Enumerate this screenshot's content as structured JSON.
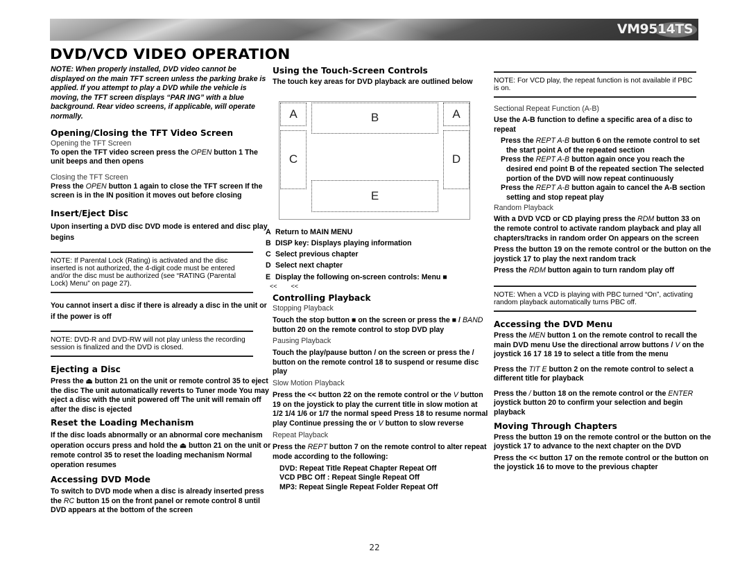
{
  "header": {
    "model": "VM9514TS",
    "page_title": "DVD/VCD VIDEO OPERATION"
  },
  "col1": {
    "intro_note": "NOTE: When properly installed, DVD video cannot be displayed on the main TFT screen unless the parking brake is applied. If you attempt to play a DVD while the vehicle is moving, the TFT screen displays “PAR ING” with a blue background. Rear video screens, if applicable, will operate normally.",
    "opening_heading": "Opening/Closing the TFT Video Screen",
    "opening_sub": "Opening the TFT Screen",
    "opening_text_a": "To open the TFT video screen  press the ",
    "opening_text_btn": "OPEN",
    "opening_text_b": " button  1  The unit beeps and then opens",
    "closing_sub": "Closing the TFT Screen",
    "closing_text_a": "Press the ",
    "closing_text_btn": "OPEN",
    "closing_text_b": " button  1  again to close the TFT screen  If the screen is in the IN position  it moves out before closing",
    "insert_heading": "Insert/Eject Disc",
    "insert_text": "Upon inserting a DVD disc  DVD mode is entered and disc play begins",
    "parental_note": "NOTE: If Parental Lock (Rating) is activated and the disc inserted is not authorized, the 4-digit code must be entered and/or the disc must be authorized (see “RATING (Parental Lock) Menu” on page 27).",
    "cannot_insert": "You cannot insert a disc if there is already a disc in the unit or if the power is off",
    "dvdr_note": "NOTE: DVD-R and DVD-RW will not play unless the recording session is finalized and the DVD is closed.",
    "eject_heading": "Ejecting a Disc",
    "eject_text": "Press the ⏏  button  21  on the unit or remote control  35  to eject the disc  The unit automatically reverts to Tuner mode  You may eject a disc with the unit powered off  The unit will remain off after the disc is ejected",
    "reset_heading": "Reset the Loading Mechanism",
    "reset_text": "If the disc loads abnormally or an abnormal core mechanism operation occurs  press and hold the ⏏  button  21  on the unit or remote control  35  to reset the loading mechanism  Normal operation resumes",
    "mode_heading": "Accessing DVD Mode",
    "mode_text_a": "To switch to DVD mode when a disc is already inserted press the ",
    "mode_text_btn": "RC",
    "mode_text_b": "  button  15  on the front panel or remote control  8  until DVD appears at the bottom of the screen"
  },
  "col2": {
    "touch_heading": "Using the Touch-Screen Controls",
    "touch_intro": "The touch key areas for DVD playback are outlined below",
    "zones": [
      "A",
      "B",
      "A",
      "C",
      "D",
      "E"
    ],
    "legend": [
      {
        "key": "A",
        "text": "Return to MAIN MENU"
      },
      {
        "key": "B",
        "text": "DISP key: Displays playing information"
      },
      {
        "key": "C",
        "text": "Select previous chapter"
      },
      {
        "key": "D",
        "text": "Select next chapter"
      },
      {
        "key": "E",
        "text": "Display the following on-screen controls: Menu  ■"
      }
    ],
    "legend_e_cont": "<<        <<",
    "playback_heading": "Controlling Playback",
    "stop_sub": "Stopping Playback",
    "stop_text_a": "Touch the stop button ■   on the screen or press the ■  /  ",
    "stop_text_btn": "BAND",
    "stop_text_b": " button  20  on the remote control to stop DVD play",
    "pause_sub": "Pausing Playback",
    "pause_text": "Touch the play/pause button /   on the screen or press the  /   button on the remote control  18  to suspend or resume disc play",
    "slow_sub": "Slow Motion Playback",
    "slow_text_a": "Press the << button  22  on the remote control or the ",
    "slow_text_v": "V",
    "slow_text_b": " button  19  on the joystick to play the current title in slow motion at 1/2  1/4  1/6 or 1/7  the normal speed  Press    18  to resume normal play  Continue pressing the  or ",
    "slow_text_v2": "V",
    "slow_text_c": " button to slow reverse",
    "repeat_sub": "Repeat Playback",
    "repeat_text_a": "Press the ",
    "repeat_text_btn": "REPT",
    "repeat_text_b": " button  7  on the remote control to alter repeat mode according to the following:",
    "repeat_modes": [
      "DVD: Repeat Title  Repeat Chapter  Repeat Off",
      "VCD  PBC Off : Repeat Single  Repeat Off",
      "MP3: Repeat Single  Repeat Folder  Repeat Off"
    ]
  },
  "col3": {
    "vcd_note": "NOTE: For VCD play, the repeat function is not available if PBC is on.",
    "ab_sub": "Sectional Repeat Function (A-B)",
    "ab_text": "Use the A-B function to define a specific area of a disc to repeat",
    "ab_steps": [
      {
        "a": "Press the ",
        "btn": "REPT A-B",
        "b": " button  6  on the remote control to set the start point  A  of the repeated section"
      },
      {
        "a": "Press the ",
        "btn": "REPT A-B",
        "b": " button again once you reach the desired end point  B  of the repeated section  The selected portion of the DVD will now repeat continuously"
      },
      {
        "a": "Press the ",
        "btn": "REPT A-B",
        "b": " button again to cancel the A-B section setting and stop repeat play"
      }
    ],
    "random_sub": "Random Playback",
    "random_text_a": "With a DVD  VCD  or CD playing  press the ",
    "random_text_btn": "RDM",
    "random_text_b": " button  33  on the remote control to activate random playback and play all chapters/tracks in random order  On appears on the screen",
    "random_next": "Press the      button  19  on the remote control or the button on the joystick  17  to play the next random track",
    "random_off_a": "Press the ",
    "random_off_btn": "RDM",
    "random_off_b": " button again to turn random play off",
    "pbc_note": "NOTE: When a VCD is playing with PBC turned “On”, activating random playback automatically turns PBC off.",
    "menu_heading": "Accessing the DVD Menu",
    "menu_text_a": "Press the ",
    "menu_text_btn": "MEN",
    "menu_text_b": "    button  1  on the remote control to recall the main DVD menu  Use the directional  arrow  buttons       /      ",
    "menu_text_v": "V",
    "menu_text_c": "  on the joystick  16  17  18  19  to select a title from the menu",
    "title_text_a": "Press the ",
    "title_text_btn": "TIT E",
    "title_text_b": "  button  2  on the remote control to select a different title for playback",
    "enter_text_a": "Press the ",
    "enter_text_sym": "/",
    "enter_text_b": "    button  18  on the remote control or the ",
    "enter_text_btn": "ENTER",
    "enter_text_c": " joystick  button  20  to confirm your selection and begin playback",
    "chapters_heading": "Moving Through Chapters",
    "chapter_next": "Press the      button  19  on the remote control or the button on the joystick  17  to advance to the next chapter on the DVD",
    "chapter_prev": "Press the << button  17  on the remote control or the button on the joystick  16  to move to the previous chapter"
  },
  "footer": {
    "page_number": "22"
  }
}
